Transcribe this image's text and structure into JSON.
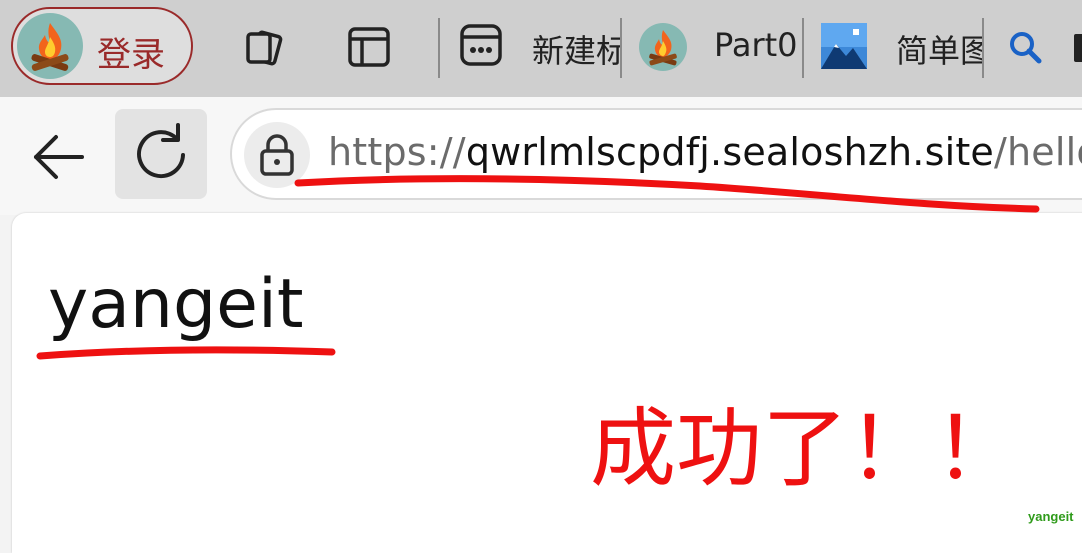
{
  "tabbar": {
    "login_label": "登录",
    "tabs": [
      {
        "title": "新建标",
        "icon": "more-app-icon"
      },
      {
        "title": "Part0",
        "icon": "campfire-favicon"
      },
      {
        "title": "简单图",
        "icon": "image-favicon"
      }
    ],
    "icons": [
      "collections-icon",
      "split-tab-icon",
      "search-icon"
    ]
  },
  "navbar": {
    "url_scheme": "https://",
    "url_host": "qwrlmlscpdfj.sealoshzh.site",
    "url_path": "/hello",
    "icons": [
      "back-arrow-icon",
      "reload-icon",
      "lock-icon"
    ]
  },
  "page": {
    "body_text": "yangeit",
    "annotation_text": "成功了！！",
    "watermark": "yangeit"
  },
  "colors": {
    "annotation_red": "#ee1111",
    "login_accent": "#9a2a2a",
    "watermark_green": "#2f9b1b"
  }
}
